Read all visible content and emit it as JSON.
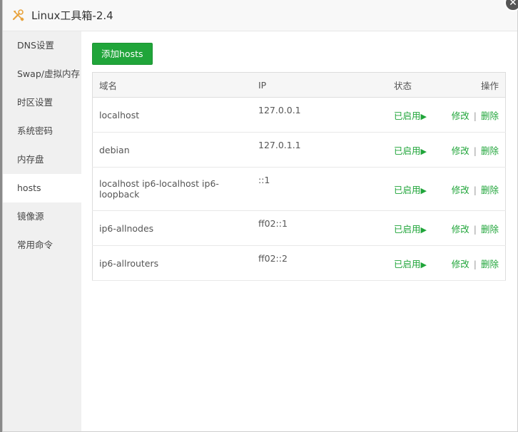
{
  "window": {
    "title": "Linux工具箱-2.4",
    "icon": "tools-icon",
    "close_glyph": "✕",
    "accent": "#20a53a"
  },
  "sidebar": {
    "items": [
      {
        "label": "DNS设置"
      },
      {
        "label": "Swap/虚拟内存"
      },
      {
        "label": "时区设置"
      },
      {
        "label": "系统密码"
      },
      {
        "label": "内存盘"
      },
      {
        "label": "hosts",
        "active": true
      },
      {
        "label": "镜像源"
      },
      {
        "label": "常用命令"
      }
    ]
  },
  "main": {
    "add_button": "添加hosts",
    "table": {
      "headers": {
        "domain": "域名",
        "ip": "IP",
        "status": "状态",
        "ops": "操作"
      },
      "rows": [
        {
          "domain": "localhost",
          "ip": "127.0.0.1",
          "status": "已启用",
          "edit": "修改",
          "delete": "删除"
        },
        {
          "domain": "debian",
          "ip": "127.0.1.1",
          "status": "已启用",
          "edit": "修改",
          "delete": "删除"
        },
        {
          "domain": "localhost ip6-localhost ip6-loopback",
          "ip": "::1",
          "status": "已启用",
          "edit": "修改",
          "delete": "删除"
        },
        {
          "domain": "ip6-allnodes",
          "ip": "ff02::1",
          "status": "已启用",
          "edit": "修改",
          "delete": "删除"
        },
        {
          "domain": "ip6-allrouters",
          "ip": "ff02::2",
          "status": "已启用",
          "edit": "修改",
          "delete": "删除"
        }
      ],
      "separator": "|",
      "status_glyph": "▶"
    }
  }
}
